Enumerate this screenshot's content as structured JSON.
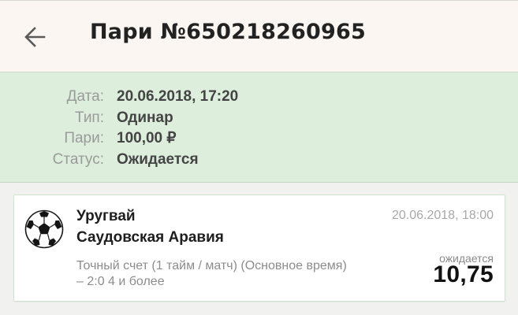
{
  "header": {
    "back_icon": "arrow-left-icon",
    "title": "Пари №650218260965"
  },
  "summary": {
    "rows": [
      {
        "label": "Дата:",
        "value": "20.06.2018, 17:20"
      },
      {
        "label": "Тип:",
        "value": "Одинар"
      },
      {
        "label": "Пари:",
        "value": "100,00 ₽"
      },
      {
        "label": "Статус:",
        "value": "Ожидается"
      }
    ]
  },
  "event": {
    "sport_icon": "soccer-ball-icon",
    "team_home": "Уругвай",
    "team_away": "Саудовская Аравия",
    "date": "20.06.2018, 18:00",
    "market_line1": "Точный счет (1 тайм / матч) (Основное время)",
    "market_line2": "– 2:0 4 и более",
    "status": "ожидается",
    "odds": "10,75"
  },
  "colors": {
    "header_bg": "#fbf6f2",
    "summary_bg": "#ddeedd",
    "card_border": "#cfe1cf",
    "page_bg": "#f1f2ef"
  }
}
